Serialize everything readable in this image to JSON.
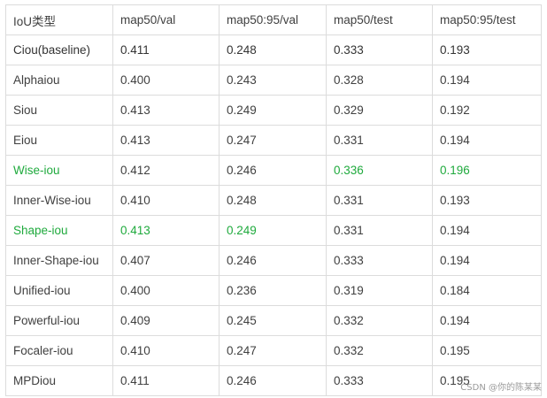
{
  "table": {
    "columns": [
      "IoU类型",
      "map50/val",
      "map50:95/val",
      "map50/test",
      "map50:95/test"
    ],
    "rows": [
      {
        "cells": [
          "Ciou(baseline)",
          "0.411",
          "0.248",
          "0.333",
          "0.193"
        ]
      },
      {
        "cells": [
          "Alphaiou",
          "0.400",
          "0.243",
          "0.328",
          "0.194"
        ]
      },
      {
        "cells": [
          "Siou",
          "0.413",
          "0.249",
          "0.329",
          "0.192"
        ]
      },
      {
        "cells": [
          "Eiou",
          "0.413",
          "0.247",
          "0.331",
          "0.194"
        ]
      },
      {
        "cells": [
          "Wise-iou",
          "0.412",
          "0.246",
          "0.336",
          "0.196"
        ]
      },
      {
        "cells": [
          "Inner-Wise-iou",
          "0.410",
          "0.248",
          "0.331",
          "0.193"
        ]
      },
      {
        "cells": [
          "Shape-iou",
          "0.413",
          "0.249",
          "0.331",
          "0.194"
        ]
      },
      {
        "cells": [
          "Inner-Shape-iou",
          "0.407",
          "0.246",
          "0.333",
          "0.194"
        ]
      },
      {
        "cells": [
          "Unified-iou",
          "0.400",
          "0.236",
          "0.319",
          "0.184"
        ]
      },
      {
        "cells": [
          "Powerful-iou",
          "0.409",
          "0.245",
          "0.332",
          "0.194"
        ]
      },
      {
        "cells": [
          "Focaler-iou",
          "0.410",
          "0.247",
          "0.332",
          "0.195"
        ]
      },
      {
        "cells": [
          "MPDiou",
          "0.411",
          "0.246",
          "0.333",
          "0.195"
        ]
      }
    ]
  },
  "colors": {
    "highlight": "#1faa3d",
    "text": "#404040",
    "border": "#dcdcdc"
  },
  "watermark": "CSDN @你的陈某某"
}
